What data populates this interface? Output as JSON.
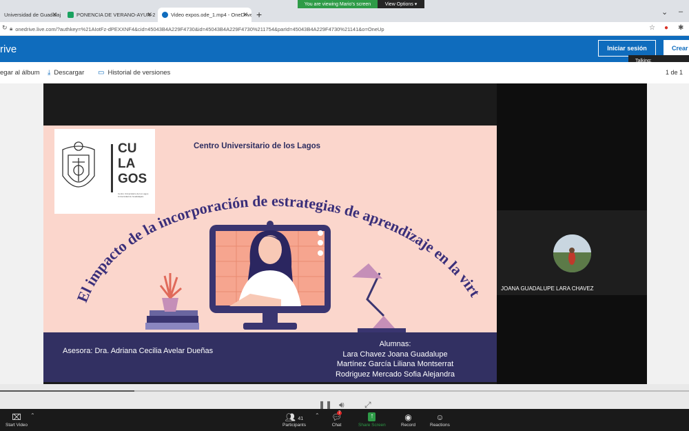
{
  "browser": {
    "share_banner": "You are viewing Mario's screen",
    "view_options": "View Options ▾",
    "tabs": [
      {
        "label": "Universidad de Guadalajara",
        "color": "#c7972b"
      },
      {
        "label": "PONENCIA DE VERANO-AYUN-2",
        "color": "#1aa260"
      },
      {
        "label": "Video expos.ode_1.mp4 - OneDrive",
        "color": "#0f6cbd"
      }
    ],
    "url": "onedrive.live.com/?authkey=%21AIotFz-dPEXXNF4&cid=45043B4A229F4730&id=45043B4A229F4730%211754&parId=45043B4A229F4730%21141&o=OneUp"
  },
  "onedrive": {
    "title": "rive",
    "signin_label": "Iniciar sesión",
    "create_label": "Crear",
    "tooltip": "Talking:",
    "cmd_album": "egar al álbum",
    "cmd_download": "Descargar",
    "cmd_history": "Historial de versiones",
    "pager": "1 de 1"
  },
  "slide": {
    "university": "Centro Universitario de los Lagos",
    "logo_text": [
      "CU",
      "LA",
      "GOS"
    ],
    "logo_caption": "Centro Universitario de los Lagos Universidad de Guadalajara",
    "title": "El impacto de la incorporación de estrategias de aprendizaje en la virtualidad.",
    "asesora": "Asesora: Dra. Adriana Cecilia Avelar Dueñas",
    "alumnas_label": "Alumnas:",
    "alumnas": [
      "Lara Chavez Joana Guadalupe",
      "Martínez García Liliana Montserrat",
      "Rodriguez Mercado Sofia Alejandra"
    ]
  },
  "participant": {
    "name": "JOANA GUADALUPE LARA CHAVEZ"
  },
  "zoom": {
    "start_video": "Start Video",
    "participants": "Participants",
    "participants_count": "41",
    "chat": "Chat",
    "chat_badge": "7",
    "share_screen": "Share Screen",
    "record": "Record",
    "reactions": "Reactions"
  },
  "colors": {
    "onedrive_blue": "#0f6cbd",
    "slide_pink": "#fbd6cc",
    "slide_navy": "#323062",
    "share_green": "#2e9b47"
  }
}
